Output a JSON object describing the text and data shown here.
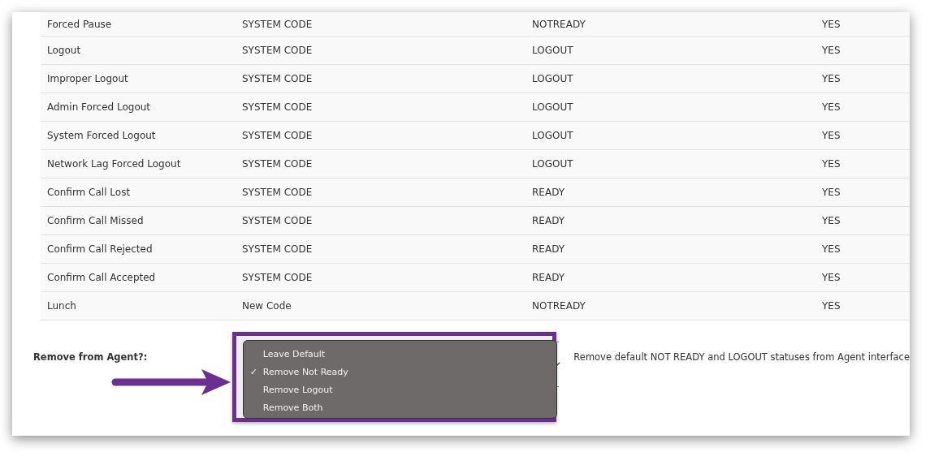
{
  "table": {
    "rows": [
      {
        "cells": [
          "Forced Pause",
          "SYSTEM CODE",
          "NOTREADY",
          "YES"
        ]
      },
      {
        "cells": [
          "Logout",
          "SYSTEM CODE",
          "LOGOUT",
          "YES"
        ]
      },
      {
        "cells": [
          "Improper Logout",
          "SYSTEM CODE",
          "LOGOUT",
          "YES"
        ]
      },
      {
        "cells": [
          "Admin Forced Logout",
          "SYSTEM CODE",
          "LOGOUT",
          "YES"
        ]
      },
      {
        "cells": [
          "System Forced Logout",
          "SYSTEM CODE",
          "LOGOUT",
          "YES"
        ]
      },
      {
        "cells": [
          "Network Lag Forced Logout",
          "SYSTEM CODE",
          "LOGOUT",
          "YES"
        ]
      },
      {
        "cells": [
          "Confirm Call Lost",
          "SYSTEM CODE",
          "READY",
          "YES"
        ]
      },
      {
        "cells": [
          "Confirm Call Missed",
          "SYSTEM CODE",
          "READY",
          "YES"
        ]
      },
      {
        "cells": [
          "Confirm Call Rejected",
          "SYSTEM CODE",
          "READY",
          "YES"
        ]
      },
      {
        "cells": [
          "Confirm Call Accepted",
          "SYSTEM CODE",
          "READY",
          "YES"
        ]
      },
      {
        "cells": [
          "Lunch",
          "New Code",
          "NOTREADY",
          "YES"
        ]
      }
    ]
  },
  "setting": {
    "label": "Remove from Agent?:",
    "options": [
      {
        "label": "Leave Default",
        "selected": false
      },
      {
        "label": "Remove Not Ready",
        "selected": true
      },
      {
        "label": "Remove Logout",
        "selected": false
      },
      {
        "label": "Remove Both",
        "selected": false
      }
    ],
    "check": "✓",
    "description": "Remove default NOT READY and LOGOUT statuses from Agent interface"
  }
}
